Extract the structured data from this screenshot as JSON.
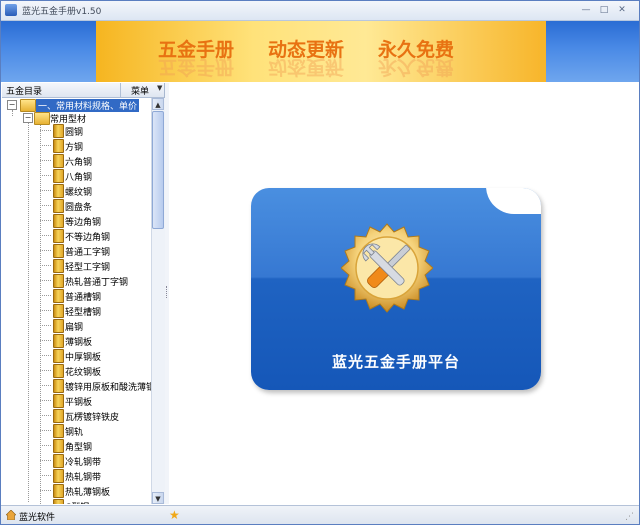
{
  "window": {
    "title": "蓝光五金手册v1.50",
    "minimize_label": "—",
    "maximize_label": "□",
    "close_label": "✕"
  },
  "banner": {
    "slogan_1": "五金手册",
    "slogan_2": "动态更新",
    "slogan_3": "永久免费"
  },
  "tree": {
    "header_title": "五金目录",
    "menu_label": "菜单",
    "root": {
      "label": "一、常用材料规格、单价",
      "expander": "−"
    },
    "group": {
      "label": "常用型材",
      "expander": "−"
    },
    "items": [
      "圆钢",
      "方钢",
      "六角钢",
      "八角钢",
      "螺纹钢",
      "圆盘条",
      "等边角钢",
      "不等边角钢",
      "普通工字钢",
      "轻型工字钢",
      "热轧普通丁字钢",
      "普通槽钢",
      "轻型槽钢",
      "扁钢",
      "薄钢板",
      "中厚钢板",
      "花纹钢板",
      "镀锌用原板和酸洗薄钢板",
      "平钢板",
      "瓦楞镀锌铁皮",
      "钢轨",
      "角型钢",
      "冷轧钢带",
      "热轧钢带",
      "热轧薄钢板",
      "C型钢"
    ]
  },
  "content": {
    "card_title": "蓝光五金手册平台"
  },
  "statusbar": {
    "text": "蓝光软件"
  },
  "colors": {
    "accent_blue": "#316ac5",
    "banner_orange": "#e87212",
    "card_blue": "#1f63c2"
  },
  "icons": {
    "app": "app-icon",
    "folder": "folder-icon",
    "book": "book-icon",
    "tools": "wrench-screwdriver-icon",
    "home": "home-icon",
    "star": "star-icon"
  }
}
